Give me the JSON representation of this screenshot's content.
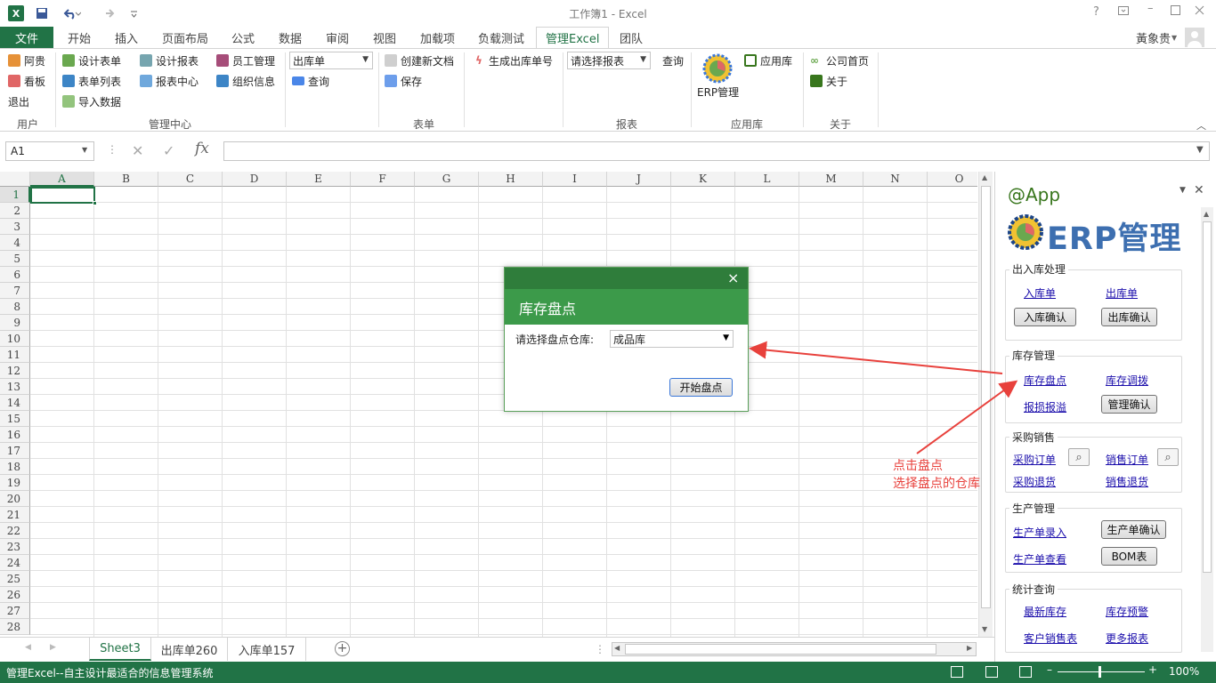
{
  "window": {
    "title": "工作簿1 - Excel",
    "help": "?",
    "user": "黃象贵"
  },
  "tabs": [
    "文件",
    "开始",
    "插入",
    "页面布局",
    "公式",
    "数据",
    "审阅",
    "视图",
    "加载项",
    "负载测试",
    "管理Excel",
    "团队"
  ],
  "active_tab": "管理Excel",
  "ribbon": {
    "user_group": {
      "items": [
        "阿贵",
        "看板",
        "退出"
      ],
      "label": "用户"
    },
    "mgmt_group": {
      "col1": [
        "设计表单",
        "表单列表",
        "导入数据"
      ],
      "col2": [
        "设计报表",
        "报表中心"
      ],
      "col3": [
        "员工管理",
        "组织信息"
      ],
      "label": "管理中心"
    },
    "form_group": {
      "dropdown": "出库单",
      "query": "查询",
      "new_doc": "创建新文档",
      "save": "保存",
      "gen_no": "生成出库单号",
      "label": "表单"
    },
    "report_group": {
      "dropdown": "请选择报表",
      "query": "查询",
      "label": "报表"
    },
    "app_group": {
      "erp": "ERP管理",
      "app": "应用库",
      "label": "应用库"
    },
    "about_group": {
      "home": "公司首页",
      "about": "关于",
      "label": "关于"
    }
  },
  "formula": {
    "namebox": "A1",
    "fx": "fx"
  },
  "columns": [
    "A",
    "B",
    "C",
    "D",
    "E",
    "F",
    "G",
    "H",
    "I",
    "J",
    "K",
    "L",
    "M",
    "N",
    "O"
  ],
  "rows": [
    "1",
    "2",
    "3",
    "4",
    "5",
    "6",
    "7",
    "8",
    "9",
    "10",
    "11",
    "12",
    "13",
    "14",
    "15",
    "16",
    "17",
    "18",
    "19",
    "20",
    "21",
    "22",
    "23",
    "24",
    "25",
    "26",
    "27",
    "28"
  ],
  "sheets": [
    "Sheet3",
    "出库单260",
    "入库单157"
  ],
  "status": {
    "text": "管理Excel--自主设计最适合的信息管理系统",
    "zoom": "100%"
  },
  "panel": {
    "header": "@App",
    "logo_text": "ERP管理",
    "s1": {
      "title": "出入库处理",
      "l1": "入库单",
      "l2": "出库单",
      "b1": "入库确认",
      "b2": "出库确认"
    },
    "s2": {
      "title": "库存管理",
      "l1": "库存盘点",
      "l2": "库存调拨",
      "l3": "报损报溢",
      "b1": "管理确认"
    },
    "s3": {
      "title": "采购销售",
      "l1": "采购订单",
      "l2": "销售订单",
      "l3": "采购退货",
      "l4": "销售退货"
    },
    "s4": {
      "title": "生产管理",
      "l1": "生产单录入",
      "l2": "生产单查看",
      "b1": "生产单确认",
      "b2": "BOM表"
    },
    "s5": {
      "title": "统计查询",
      "l1": "最新库存",
      "l2": "库存预警",
      "l3": "客户销售表",
      "l4": "更多报表"
    }
  },
  "dialog": {
    "title": "库存盘点",
    "label": "请选择盘点仓库:",
    "value": "成品库",
    "button": "开始盘点",
    "close": "×"
  },
  "annotation": {
    "line1": "点击盘点",
    "line2": "选择盘点的仓库",
    "color": "#e8413c"
  },
  "colors": {
    "accent": "#217346"
  }
}
